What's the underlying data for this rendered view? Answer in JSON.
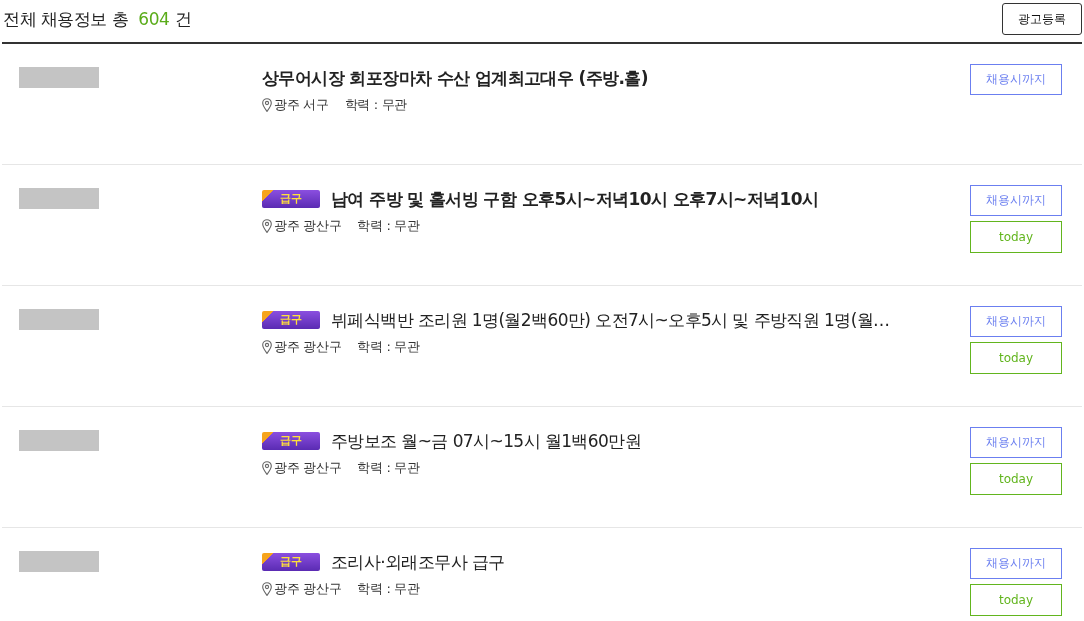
{
  "header": {
    "title": "전체 채용정보 총",
    "count": "604",
    "unit": "건",
    "button": "광고등록"
  },
  "listings": [
    {
      "title": "상무어시장 회포장마차 수산 업계최고대우 (주방.홀)",
      "emphasized": true,
      "location": "광주 서구",
      "education": "학력 : 무관",
      "deadline": "채용시까지"
    },
    {
      "badge": "급구",
      "title": "남여 주방 및 홀서빙 구함 오후5시~저녁10시 오후7시~저녁10시",
      "emphasized": true,
      "location": "광주 광산구",
      "education": "학력 : 무관",
      "deadline": "채용시까지",
      "tag": "today"
    },
    {
      "badge": "급구",
      "title": "뷔페식백반 조리원 1명(월2백60만) 오전7시~오후5시 및 주방직원 1명(월…",
      "emphasized": false,
      "location": "광주 광산구",
      "education": "학력 : 무관",
      "deadline": "채용시까지",
      "tag": "today"
    },
    {
      "badge": "급구",
      "title": "주방보조 월~금 07시~15시 월1백60만원",
      "emphasized": false,
      "location": "광주 광산구",
      "education": "학력 : 무관",
      "deadline": "채용시까지",
      "tag": "today"
    },
    {
      "badge": "급구",
      "title": "조리사·외래조무사 급구",
      "emphasized": false,
      "location": "광주 광산구",
      "education": "학력 : 무관",
      "deadline": "채용시까지",
      "tag": "today"
    }
  ]
}
